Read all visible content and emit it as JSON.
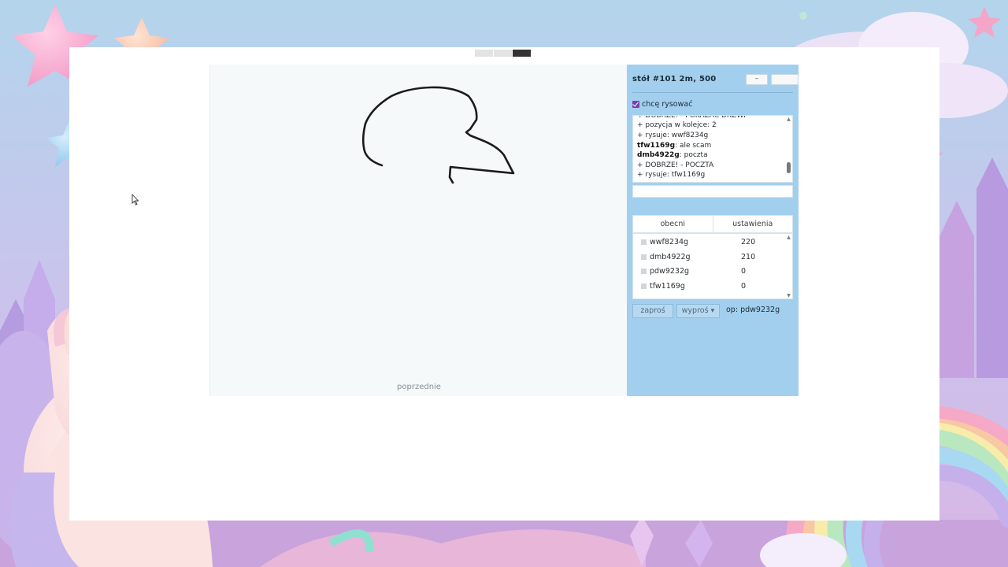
{
  "window": {
    "table_title": "stół #101   2m, 500",
    "minimize_label": "–"
  },
  "canvas": {
    "previous_label": "poprzednie"
  },
  "panel": {
    "want_draw_label": "chcę rysować",
    "want_draw_checked": true,
    "chat": [
      {
        "author": "",
        "text": "+ DOBRZE! - POKAZAĆ DRZWI"
      },
      {
        "author": "",
        "text": "+ pozycja w kolejce: 2"
      },
      {
        "author": "",
        "text": "+ rysuje: wwf8234g"
      },
      {
        "author": "tfw1169g",
        "text": ": ale scam"
      },
      {
        "author": "dmb4922g",
        "text": ": poczta"
      },
      {
        "author": "",
        "text": "+ DOBRZE! - POCZTA"
      },
      {
        "author": "",
        "text": "+ rysuje: tfw1169g"
      }
    ],
    "chat_input_value": "",
    "tabs": [
      "obecni",
      "ustawienia"
    ],
    "players": [
      {
        "name": "wwf8234g",
        "score": "220"
      },
      {
        "name": "dmb4922g",
        "score": "210"
      },
      {
        "name": "pdw9232g",
        "score": "0"
      },
      {
        "name": "tfw1169g",
        "score": "0"
      }
    ],
    "invite_label": "zaproś",
    "kick_label": "wyproś ▾",
    "op_label": "op: pdw9232g"
  },
  "colors": {
    "panel_bg": "#a2cfee",
    "canvas_bg": "#f5f9fa",
    "checkbox": "#7b3fb0"
  }
}
